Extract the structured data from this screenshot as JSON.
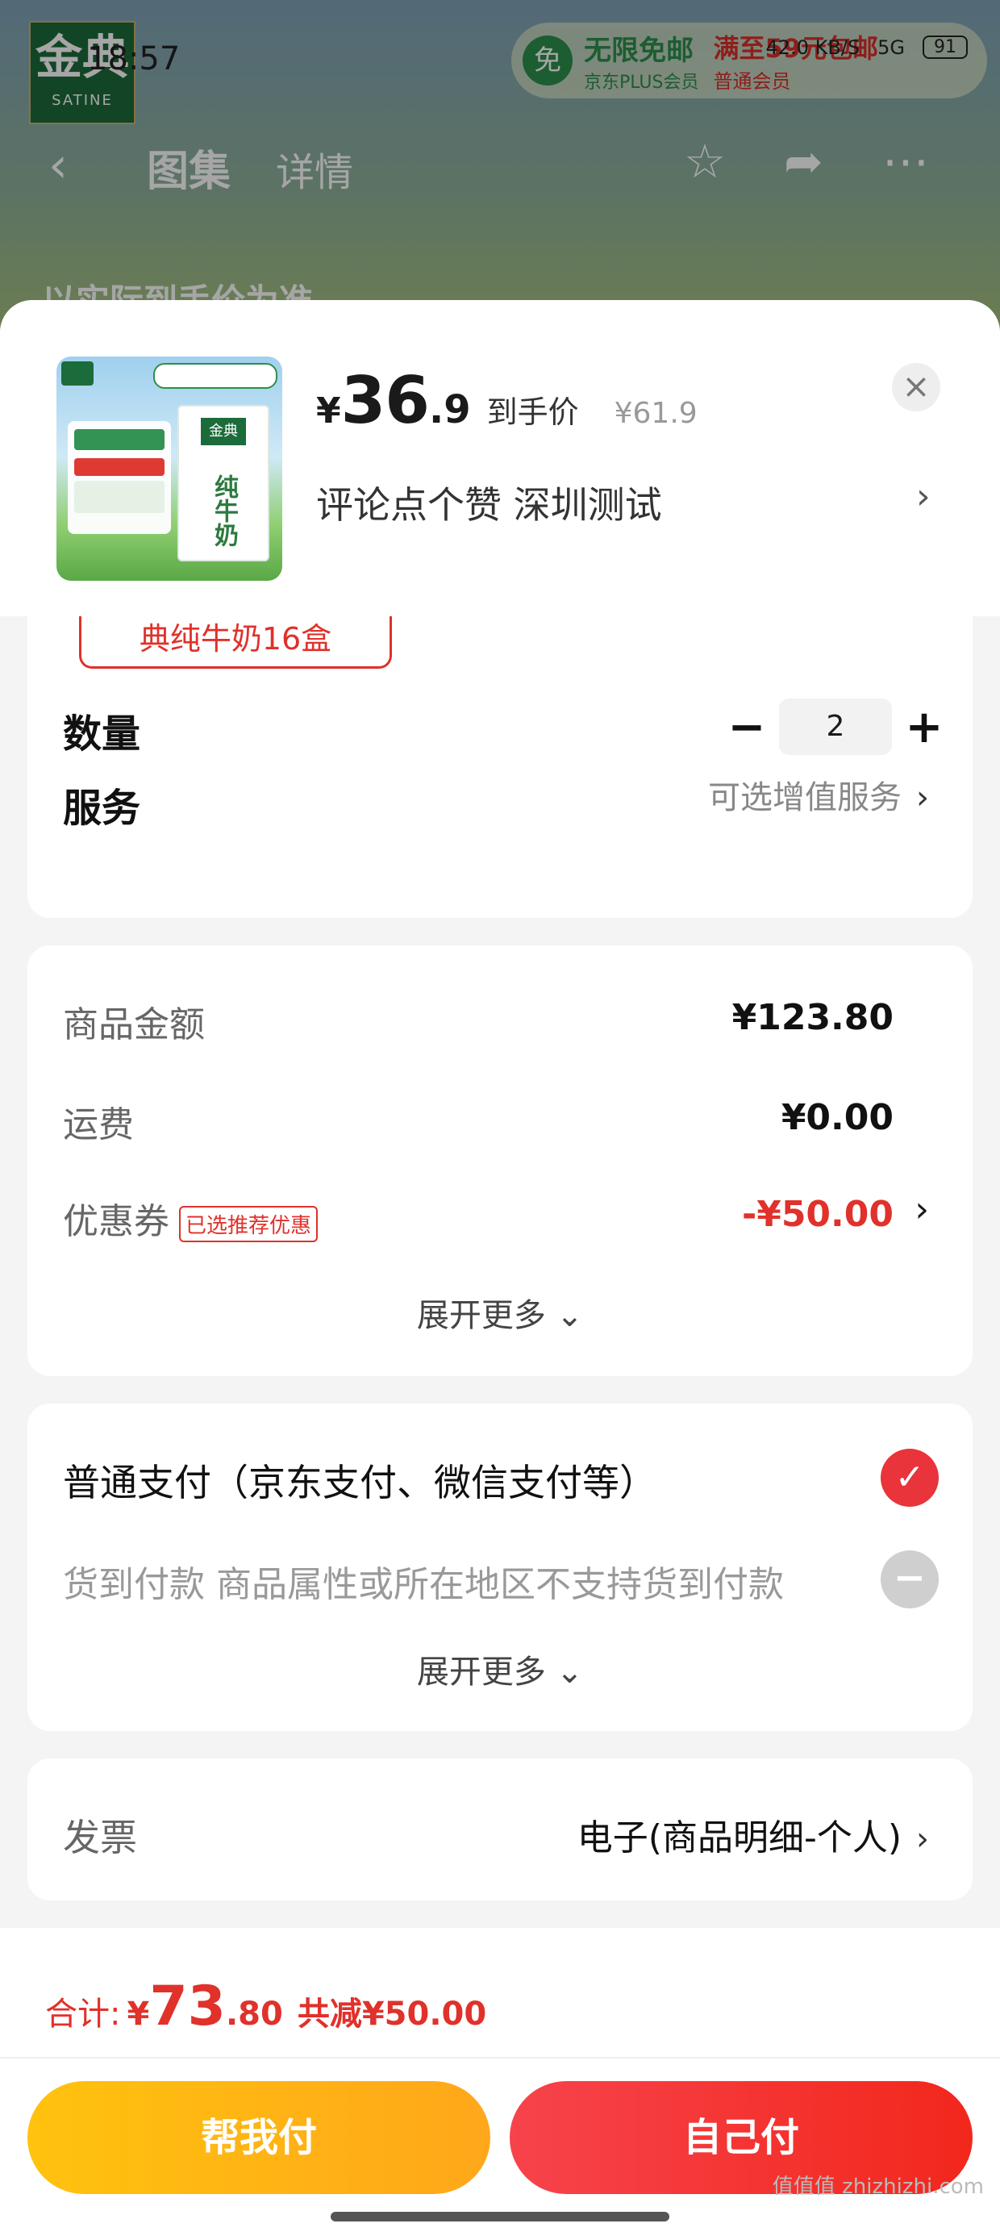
{
  "status_bar": {
    "time": "18:57",
    "net": "42.0 KB/S",
    "signal": "5G",
    "battery": "91"
  },
  "background": {
    "brand_cn": "金典",
    "brand_en": "SATINE",
    "promo_badge": "免",
    "promo_main": "无限免邮",
    "promo_sub": "京东PLUS会员",
    "promo_right": "满至59元包邮",
    "promo_right_sub": "普通会员",
    "tab_gallery": "图集",
    "tab_detail": "详情",
    "headline": "以实际到手价为准"
  },
  "product": {
    "price_symbol": "¥",
    "price_int": "36",
    "price_dec": ".9",
    "price_label": "到手价",
    "original_price": "¥61.9",
    "spec_text": "评论点个赞  深圳测试",
    "thumb_label": "纯牛奶"
  },
  "selection": {
    "spec_chip": "典纯牛奶16盒",
    "quantity_label": "数量",
    "quantity": "2",
    "minus": "−",
    "plus": "+",
    "service_label": "服务",
    "service_value": "可选增值服务"
  },
  "summary": {
    "goods_label": "商品金额",
    "goods_value": "¥123.80",
    "shipping_label": "运费",
    "shipping_value": "¥0.00",
    "coupon_label": "优惠券",
    "coupon_badge": "已选推荐优惠",
    "coupon_value": "-¥50.00",
    "expand": "展开更多"
  },
  "payment": {
    "normal": "普通支付（京东支付、微信支付等）",
    "cod": "货到付款 商品属性或所在地区不支持货到付款",
    "expand": "展开更多"
  },
  "invoice": {
    "label": "发票",
    "value": "电子(商品明细-个人)"
  },
  "footer": {
    "total_label": "合计:",
    "total_symbol": "¥",
    "total_int": "73",
    "total_dec": ".80",
    "saved": "共减¥50.00",
    "help_pay": "帮我付",
    "self_pay": "自己付"
  },
  "watermark": "值值值 zhizhizhi.com",
  "colors": {
    "accent_red": "#e0312b",
    "yellow": "#ffb514",
    "green_brand": "#1c6b3a"
  }
}
